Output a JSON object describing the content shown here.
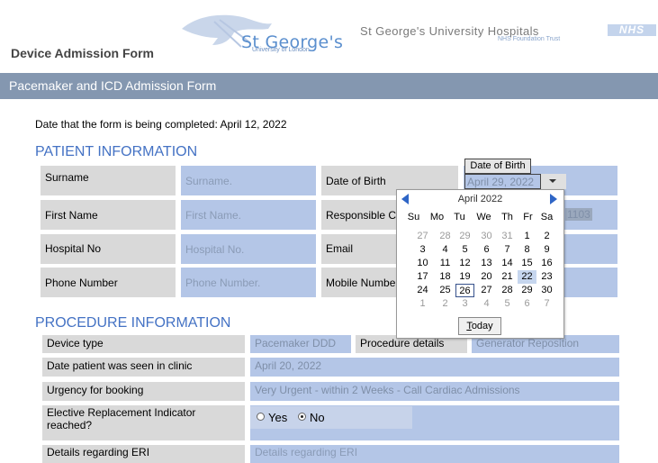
{
  "header": {
    "form_title": "Device Admission Form",
    "logo_name": "St George's",
    "logo_sub": "University of London",
    "hospital_name": "St George's University Hospitals",
    "hospital_sub": "NHS Foundation Trust",
    "nhs": "NHS"
  },
  "band_title": "Pacemaker and ICD Admission Form",
  "completed_line": "Date that the form is being completed: April 12, 2022",
  "patient": {
    "section_title": "PATIENT INFORMATION",
    "surname_label": "Surname",
    "surname_placeholder": "Surname.",
    "dob_label": "Date of Birth",
    "firstname_label": "First Name",
    "firstname_placeholder": "First Name.",
    "responsible_label": "Responsible C",
    "responsible_value": "1103",
    "hospital_no_label": "Hospital No",
    "hospital_no_placeholder": "Hospital No.",
    "email_label": "Email",
    "phone_label": "Phone Number",
    "phone_placeholder": "Phone Number.",
    "mobile_label": "Mobile Number"
  },
  "datepicker": {
    "tooltip": "Date of Birth",
    "value": "April 29, 2022",
    "month_label": "April 2022",
    "weekdays": [
      "Su",
      "Mo",
      "Tu",
      "We",
      "Th",
      "Fr",
      "Sa"
    ],
    "weeks": [
      [
        "27",
        "28",
        "29",
        "30",
        "31",
        "1",
        "2"
      ],
      [
        "3",
        "4",
        "5",
        "6",
        "7",
        "8",
        "9"
      ],
      [
        "10",
        "11",
        "12",
        "13",
        "14",
        "15",
        "16"
      ],
      [
        "17",
        "18",
        "19",
        "20",
        "21",
        "22",
        "23"
      ],
      [
        "24",
        "25",
        "26",
        "27",
        "28",
        "29",
        "30"
      ],
      [
        "1",
        "2",
        "3",
        "4",
        "5",
        "6",
        "7"
      ]
    ],
    "today_label_first": "T",
    "today_label_rest": "oday"
  },
  "procedure": {
    "section_title": "PROCEDURE INFORMATION",
    "device_type_label": "Device type",
    "device_type_value": "Pacemaker DDD",
    "procedure_details_label": "Procedure details",
    "procedure_details_value": "Generator Reposition",
    "date_seen_label": "Date patient was seen in clinic",
    "date_seen_value": "April 20, 2022",
    "urgency_label": "Urgency for booking",
    "urgency_value": "Very Urgent - within 2 Weeks - Call Cardiac Admissions",
    "eri_label_1": "Elective Replacement Indicator",
    "eri_label_2": "reached?",
    "eri_yes": "Yes",
    "eri_no": "No",
    "eri_selected": "No",
    "eri_details_label": "Details regarding ERI",
    "eri_details_placeholder": "Details regarding ERI"
  }
}
